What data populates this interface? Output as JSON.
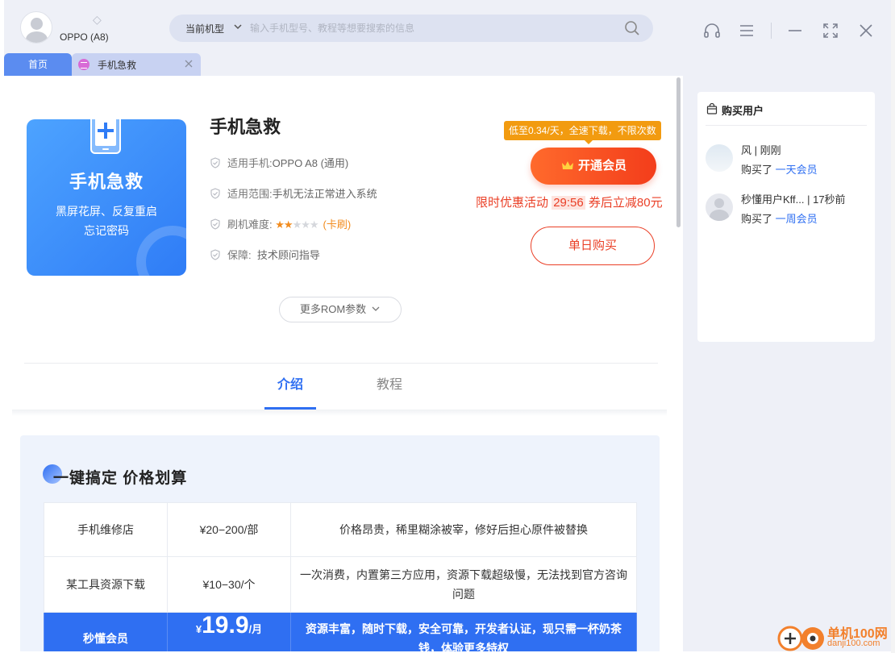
{
  "header": {
    "device_name": "OPPO (A8)",
    "model_label": "当前机型",
    "search_placeholder": "输入手机型号、教程等想要搜索的信息"
  },
  "tabs": [
    {
      "label": "首页"
    },
    {
      "label": "手机急救"
    }
  ],
  "hero": {
    "title": "手机急救",
    "subtitle_line1": "黑屏花屏、反复重启",
    "subtitle_line2": "忘记密码",
    "color_start": "#4da3ff",
    "color_end": "#2f7cf6"
  },
  "app": {
    "title": "手机急救",
    "info": [
      {
        "label": "适用手机:",
        "value": "OPPO A8 (通用)"
      },
      {
        "label": "适用范围:",
        "value": "手机无法正常进入系统"
      },
      {
        "label": "刷机难度:",
        "value": "(卡刷)",
        "stars_filled": 2,
        "stars_total": 5
      },
      {
        "label": "保障:",
        "value": "技术顾问指导"
      }
    ],
    "more_rom": "更多ROM参数"
  },
  "purchase": {
    "promo_tag": "低至0.34/天，全速下载，不限次数",
    "vip_button": "开通会员",
    "promo_prefix": "限时优惠活动",
    "timer": "29:56",
    "promo_suffix": "券后立减80元",
    "single_day_button": "单日购买",
    "accent_color": "#ea3f26"
  },
  "content_tabs": [
    {
      "label": "介绍",
      "active": true
    },
    {
      "label": "教程",
      "active": false
    }
  ],
  "section": {
    "title": "一键搞定  价格划算",
    "rows": [
      {
        "name": "手机维修店",
        "price": "¥20−200/部",
        "desc": "价格昂贵，稀里糊涂被宰，修好后担心原件被替换"
      },
      {
        "name": "某工具资源下载",
        "price": "¥10−30/个",
        "desc": "一次消费，内置第三方应用，资源下载超级慢，无法找到官方咨询问题"
      },
      {
        "name": "秒懂会员",
        "price_prefix": "¥",
        "price_value": "19.9",
        "price_unit": "/月",
        "desc": "资源丰富，随时下载，安全可靠，开发者认证，现只需一杯奶茶钱，体验更多特权"
      }
    ]
  },
  "buyers": {
    "title": "购买用户",
    "items": [
      {
        "name": "风 | 刚刚",
        "action": "购买了",
        "plan": "一天会员"
      },
      {
        "name": "秒懂用户Kff... | 17秒前",
        "action": "购买了",
        "plan": "一周会员"
      }
    ]
  },
  "watermark": {
    "name": "单机100网",
    "url": "danji100.com"
  }
}
